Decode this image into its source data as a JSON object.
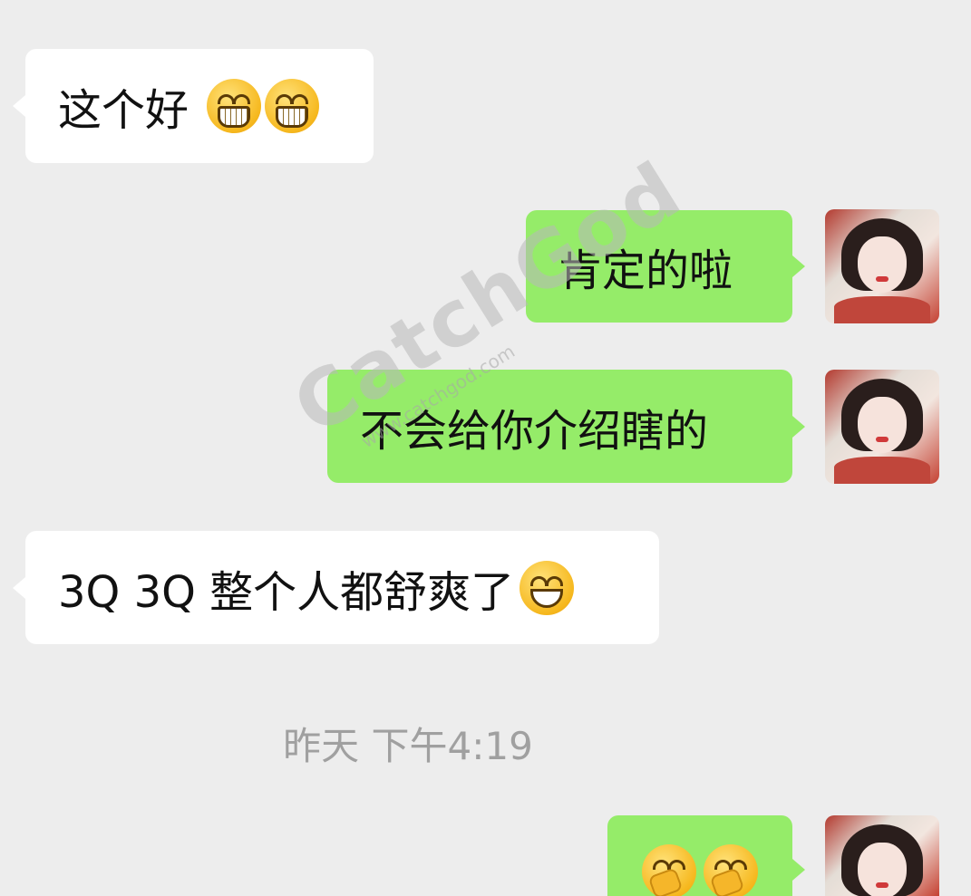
{
  "messages": [
    {
      "side": "in",
      "text": "这个好",
      "emojis": [
        "grin",
        "grin"
      ]
    },
    {
      "side": "out",
      "text": "肯定的啦"
    },
    {
      "side": "out",
      "text": "不会给你介绍瞎的"
    },
    {
      "side": "in",
      "text": "3Q 3Q 整个人都舒爽了",
      "emojis": [
        "smile"
      ]
    },
    {
      "side": "out",
      "text": "",
      "emojis": [
        "face-palm",
        "face-palm"
      ]
    }
  ],
  "timestamp": "昨天 下午4:19",
  "watermark": {
    "logo": "CatchGod",
    "url": "www.catchgod.com"
  },
  "colors": {
    "background": "#ededed",
    "incoming_bubble": "#ffffff",
    "outgoing_bubble": "#95ec69",
    "timestamp": "#a0a0a0"
  }
}
